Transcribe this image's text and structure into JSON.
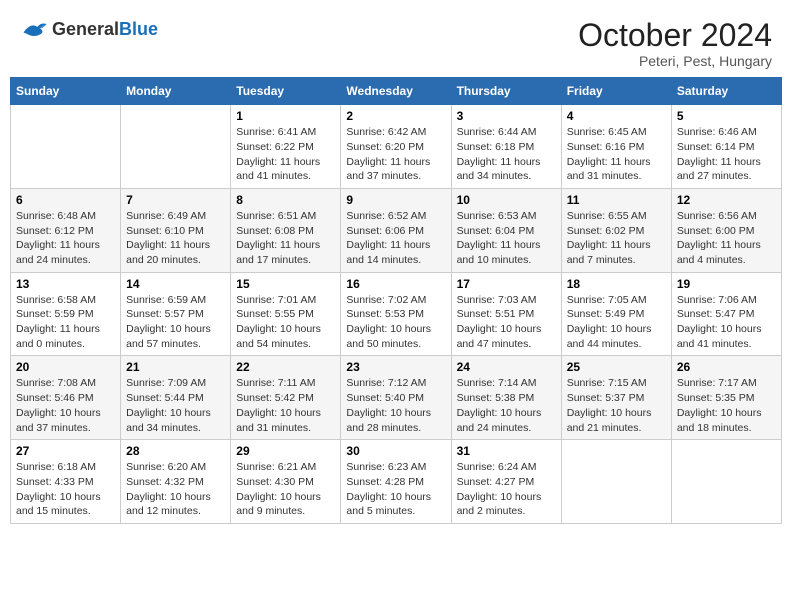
{
  "header": {
    "logo_general": "General",
    "logo_blue": "Blue",
    "month_title": "October 2024",
    "location": "Peteri, Pest, Hungary"
  },
  "weekdays": [
    "Sunday",
    "Monday",
    "Tuesday",
    "Wednesday",
    "Thursday",
    "Friday",
    "Saturday"
  ],
  "weeks": [
    [
      {
        "day": "",
        "info": ""
      },
      {
        "day": "",
        "info": ""
      },
      {
        "day": "1",
        "info": "Sunrise: 6:41 AM\nSunset: 6:22 PM\nDaylight: 11 hours\nand 41 minutes."
      },
      {
        "day": "2",
        "info": "Sunrise: 6:42 AM\nSunset: 6:20 PM\nDaylight: 11 hours\nand 37 minutes."
      },
      {
        "day": "3",
        "info": "Sunrise: 6:44 AM\nSunset: 6:18 PM\nDaylight: 11 hours\nand 34 minutes."
      },
      {
        "day": "4",
        "info": "Sunrise: 6:45 AM\nSunset: 6:16 PM\nDaylight: 11 hours\nand 31 minutes."
      },
      {
        "day": "5",
        "info": "Sunrise: 6:46 AM\nSunset: 6:14 PM\nDaylight: 11 hours\nand 27 minutes."
      }
    ],
    [
      {
        "day": "6",
        "info": "Sunrise: 6:48 AM\nSunset: 6:12 PM\nDaylight: 11 hours\nand 24 minutes."
      },
      {
        "day": "7",
        "info": "Sunrise: 6:49 AM\nSunset: 6:10 PM\nDaylight: 11 hours\nand 20 minutes."
      },
      {
        "day": "8",
        "info": "Sunrise: 6:51 AM\nSunset: 6:08 PM\nDaylight: 11 hours\nand 17 minutes."
      },
      {
        "day": "9",
        "info": "Sunrise: 6:52 AM\nSunset: 6:06 PM\nDaylight: 11 hours\nand 14 minutes."
      },
      {
        "day": "10",
        "info": "Sunrise: 6:53 AM\nSunset: 6:04 PM\nDaylight: 11 hours\nand 10 minutes."
      },
      {
        "day": "11",
        "info": "Sunrise: 6:55 AM\nSunset: 6:02 PM\nDaylight: 11 hours\nand 7 minutes."
      },
      {
        "day": "12",
        "info": "Sunrise: 6:56 AM\nSunset: 6:00 PM\nDaylight: 11 hours\nand 4 minutes."
      }
    ],
    [
      {
        "day": "13",
        "info": "Sunrise: 6:58 AM\nSunset: 5:59 PM\nDaylight: 11 hours\nand 0 minutes."
      },
      {
        "day": "14",
        "info": "Sunrise: 6:59 AM\nSunset: 5:57 PM\nDaylight: 10 hours\nand 57 minutes."
      },
      {
        "day": "15",
        "info": "Sunrise: 7:01 AM\nSunset: 5:55 PM\nDaylight: 10 hours\nand 54 minutes."
      },
      {
        "day": "16",
        "info": "Sunrise: 7:02 AM\nSunset: 5:53 PM\nDaylight: 10 hours\nand 50 minutes."
      },
      {
        "day": "17",
        "info": "Sunrise: 7:03 AM\nSunset: 5:51 PM\nDaylight: 10 hours\nand 47 minutes."
      },
      {
        "day": "18",
        "info": "Sunrise: 7:05 AM\nSunset: 5:49 PM\nDaylight: 10 hours\nand 44 minutes."
      },
      {
        "day": "19",
        "info": "Sunrise: 7:06 AM\nSunset: 5:47 PM\nDaylight: 10 hours\nand 41 minutes."
      }
    ],
    [
      {
        "day": "20",
        "info": "Sunrise: 7:08 AM\nSunset: 5:46 PM\nDaylight: 10 hours\nand 37 minutes."
      },
      {
        "day": "21",
        "info": "Sunrise: 7:09 AM\nSunset: 5:44 PM\nDaylight: 10 hours\nand 34 minutes."
      },
      {
        "day": "22",
        "info": "Sunrise: 7:11 AM\nSunset: 5:42 PM\nDaylight: 10 hours\nand 31 minutes."
      },
      {
        "day": "23",
        "info": "Sunrise: 7:12 AM\nSunset: 5:40 PM\nDaylight: 10 hours\nand 28 minutes."
      },
      {
        "day": "24",
        "info": "Sunrise: 7:14 AM\nSunset: 5:38 PM\nDaylight: 10 hours\nand 24 minutes."
      },
      {
        "day": "25",
        "info": "Sunrise: 7:15 AM\nSunset: 5:37 PM\nDaylight: 10 hours\nand 21 minutes."
      },
      {
        "day": "26",
        "info": "Sunrise: 7:17 AM\nSunset: 5:35 PM\nDaylight: 10 hours\nand 18 minutes."
      }
    ],
    [
      {
        "day": "27",
        "info": "Sunrise: 6:18 AM\nSunset: 4:33 PM\nDaylight: 10 hours\nand 15 minutes."
      },
      {
        "day": "28",
        "info": "Sunrise: 6:20 AM\nSunset: 4:32 PM\nDaylight: 10 hours\nand 12 minutes."
      },
      {
        "day": "29",
        "info": "Sunrise: 6:21 AM\nSunset: 4:30 PM\nDaylight: 10 hours\nand 9 minutes."
      },
      {
        "day": "30",
        "info": "Sunrise: 6:23 AM\nSunset: 4:28 PM\nDaylight: 10 hours\nand 5 minutes."
      },
      {
        "day": "31",
        "info": "Sunrise: 6:24 AM\nSunset: 4:27 PM\nDaylight: 10 hours\nand 2 minutes."
      },
      {
        "day": "",
        "info": ""
      },
      {
        "day": "",
        "info": ""
      }
    ]
  ]
}
